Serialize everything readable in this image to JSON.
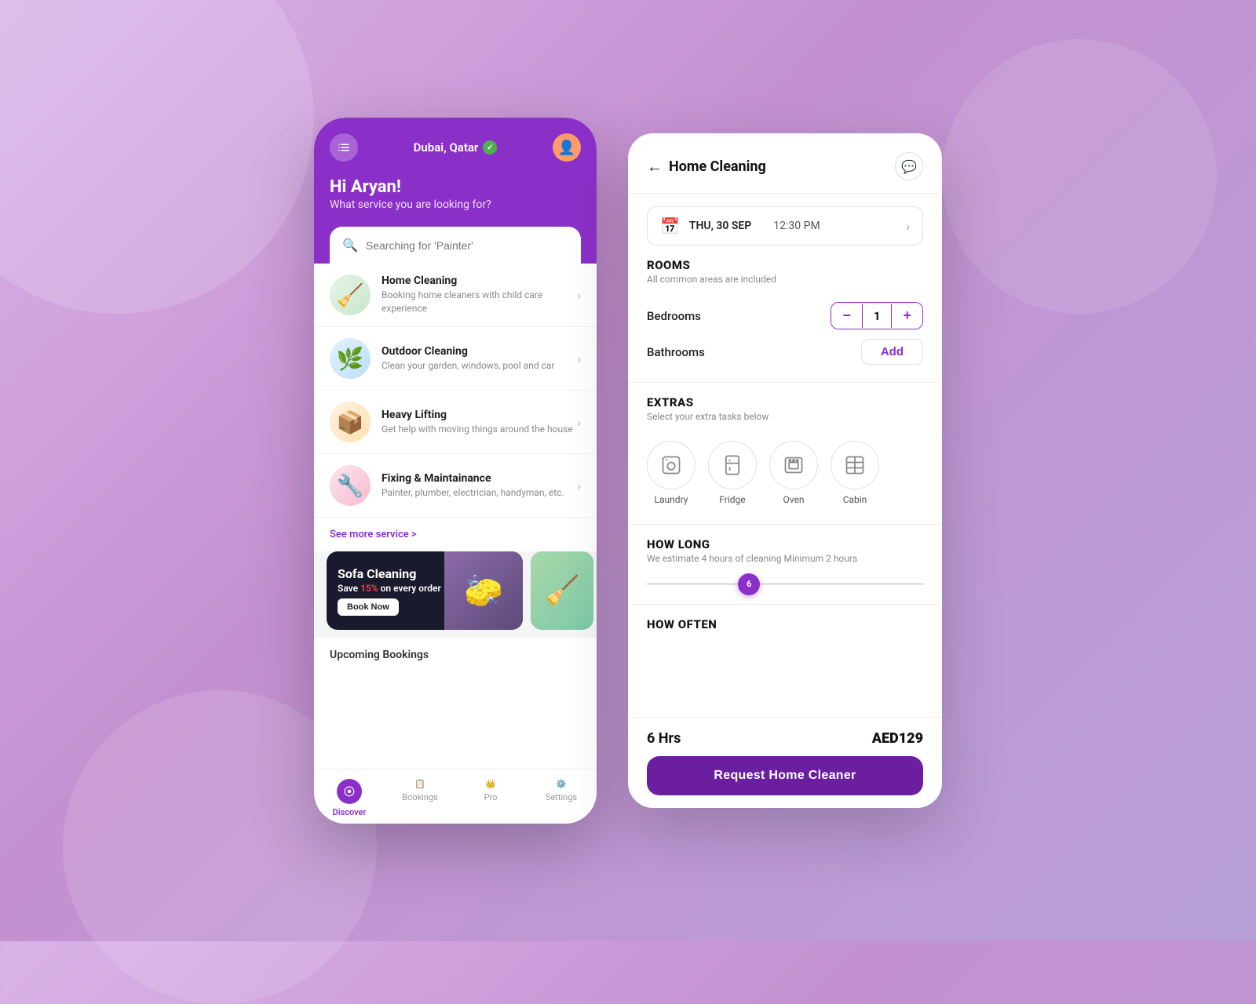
{
  "background": "#c490d1",
  "left_phone": {
    "header": {
      "location": "Dubai, Qatar",
      "greeting_title": "Hi Aryan!",
      "greeting_sub": "What service you are looking for?",
      "search_placeholder": "Searching for 'Painter'"
    },
    "services": [
      {
        "name": "Home Cleaning",
        "description": "Booking home cleaners with child care experience",
        "icon": "🧹",
        "color_class": "svc-home"
      },
      {
        "name": "Outdoor Cleaning",
        "description": "Clean your garden, windows, pool and car",
        "icon": "🌱",
        "color_class": "svc-outdoor"
      },
      {
        "name": "Heavy Lifting",
        "description": "Get help with moving things around the house",
        "icon": "📦",
        "color_class": "svc-lifting"
      },
      {
        "name": "Fixing & Maintainance",
        "description": "Painter, plumber, electrician, handyman, etc.",
        "icon": "🔧",
        "color_class": "svc-fixing"
      }
    ],
    "see_more": "See more service >",
    "banner": {
      "title": "Sofa Cleaning",
      "save_prefix": "Save ",
      "save_amount": "15%",
      "save_suffix": " on every order",
      "book_now": "Book Now"
    },
    "nav": [
      {
        "label": "Discover",
        "active": true
      },
      {
        "label": "Bookings",
        "active": false
      },
      {
        "label": "Pro",
        "active": false
      },
      {
        "label": "Settings",
        "active": false
      }
    ],
    "upcoming_title": "Upcoming Bookings"
  },
  "right_panel": {
    "title": "Home Cleaning",
    "date": "THU, 30 SEP",
    "time": "12:30 PM",
    "rooms_title": "ROOMS",
    "rooms_subtitle": "All common areas are included",
    "bedrooms_label": "Bedrooms",
    "bedrooms_count": "1",
    "bathrooms_label": "Bathrooms",
    "bathrooms_add": "Add",
    "extras_title": "EXTRAS",
    "extras_subtitle": "Select your extra tasks below",
    "extras": [
      {
        "label": "Laundry",
        "icon": "👕"
      },
      {
        "label": "Fridge",
        "icon": "🧊"
      },
      {
        "label": "Oven",
        "icon": "🍳"
      },
      {
        "label": "Cabin",
        "icon": "🗄️"
      }
    ],
    "howlong_title": "HOW LONG",
    "howlong_subtitle": "We estimate 4 hours of cleaning Minimum 2 hours",
    "slider_value": "6",
    "howoften_title": "HOW OFTEN",
    "hours_label": "6 Hrs",
    "price": "AED129",
    "request_btn": "Request Home Cleaner"
  }
}
